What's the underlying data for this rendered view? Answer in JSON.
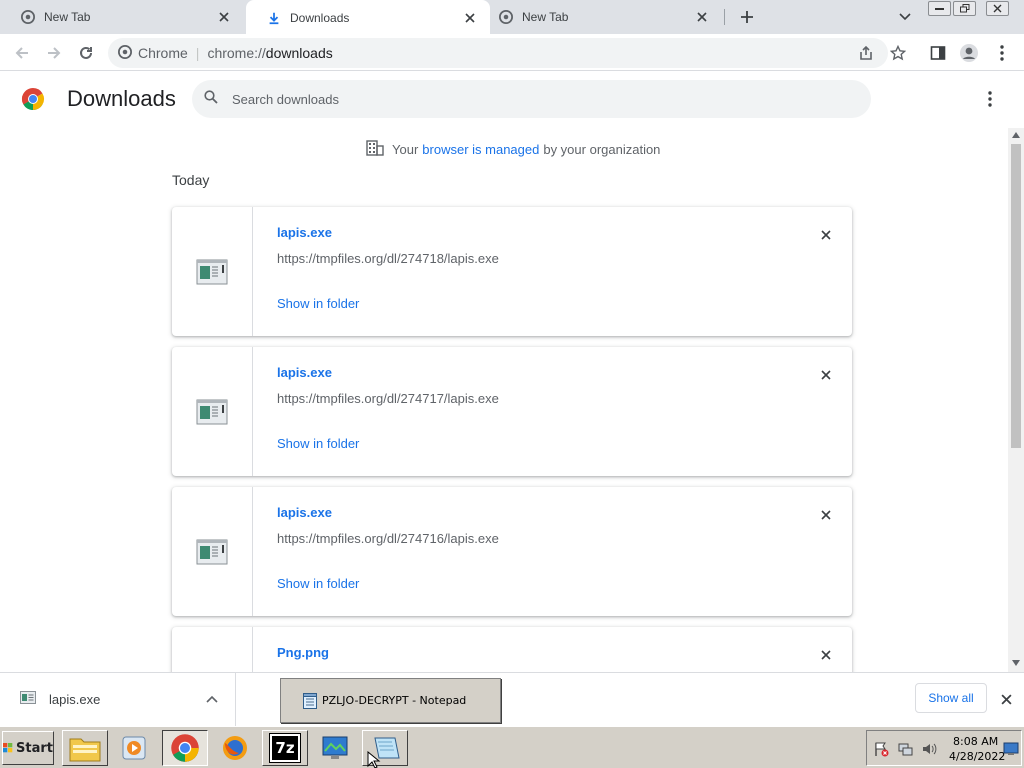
{
  "tabs": [
    {
      "title": "New Tab",
      "active": false
    },
    {
      "title": "Downloads",
      "active": true
    },
    {
      "title": "New Tab",
      "active": false
    }
  ],
  "omnibox": {
    "site_label": "Chrome",
    "url_scheme": "chrome://",
    "url_host": "downloads"
  },
  "page": {
    "title": "Downloads",
    "search_placeholder": "Search downloads"
  },
  "managed_notice": {
    "prefix": "Your",
    "link": "browser is managed",
    "suffix": "by your organization"
  },
  "section_label": "Today",
  "downloads": [
    {
      "name": "lapis.exe",
      "url": "https://tmpfiles.org/dl/274718/lapis.exe",
      "action": "Show in folder"
    },
    {
      "name": "lapis.exe",
      "url": "https://tmpfiles.org/dl/274717/lapis.exe",
      "action": "Show in folder"
    },
    {
      "name": "lapis.exe",
      "url": "https://tmpfiles.org/dl/274716/lapis.exe",
      "action": "Show in folder"
    },
    {
      "name": "Png.png",
      "url": "",
      "action": ""
    }
  ],
  "shelf": {
    "item_name": "lapis.exe",
    "show_all": "Show all"
  },
  "notepad_popup": "PZLJO-DECRYPT - Notepad",
  "taskbar": {
    "start_label": "Start",
    "seven_zip_label": "7z",
    "clock_time": "8:08 AM",
    "clock_date": "4/28/2022"
  },
  "colors": {
    "accent": "#1a73e8",
    "tabstrip": "#dee1e6",
    "taskbar": "#d4d0c8"
  }
}
